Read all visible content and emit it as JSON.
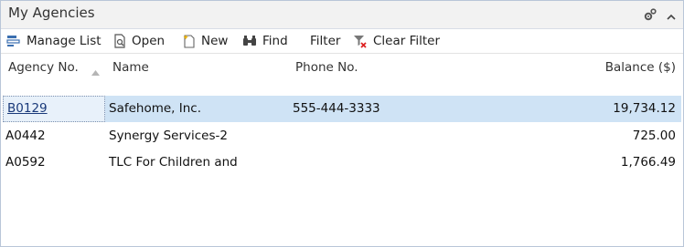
{
  "panel": {
    "title": "My Agencies",
    "header_icons": [
      "gear-icon",
      "collapse-icon"
    ]
  },
  "toolbar": {
    "manage_list": "Manage List",
    "open": "Open",
    "new": "New",
    "find": "Find",
    "filter": "Filter",
    "clear_filter": "Clear Filter"
  },
  "grid": {
    "columns": [
      "Agency No.",
      "Name",
      "Phone No.",
      "Balance ($)"
    ],
    "rows": [
      {
        "agency_no": "B0129",
        "name": "Safehome, Inc.",
        "phone": "555-444-3333",
        "balance": "19,734.12"
      },
      {
        "agency_no": "A0442",
        "name": "Synergy Services-2",
        "phone": "",
        "balance": "725.00"
      },
      {
        "agency_no": "A0592",
        "name": "TLC For Children and",
        "phone": "",
        "balance": "1,766.49"
      }
    ]
  }
}
